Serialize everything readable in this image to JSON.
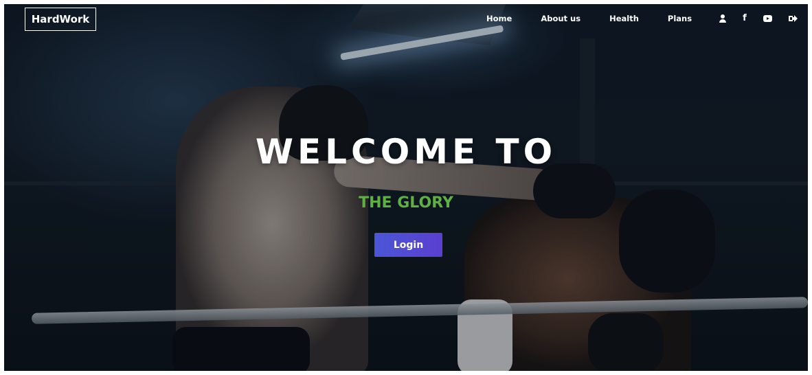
{
  "brand": {
    "logo_text": "HardWork"
  },
  "nav": {
    "links": [
      "Home",
      "About us",
      "Health",
      "Plans"
    ],
    "icons": [
      "user-icon",
      "facebook-icon",
      "youtube-icon",
      "logout-icon"
    ],
    "facebook_glyph": "f"
  },
  "hero": {
    "title": "WELCOME TO",
    "subtitle": "THE GLORY",
    "login_label": "Login"
  },
  "colors": {
    "subtitle_green": "#5fb043",
    "button_gradient_start": "#4b56d6",
    "button_gradient_end": "#5a3fd0",
    "text_white": "#ffffff"
  }
}
